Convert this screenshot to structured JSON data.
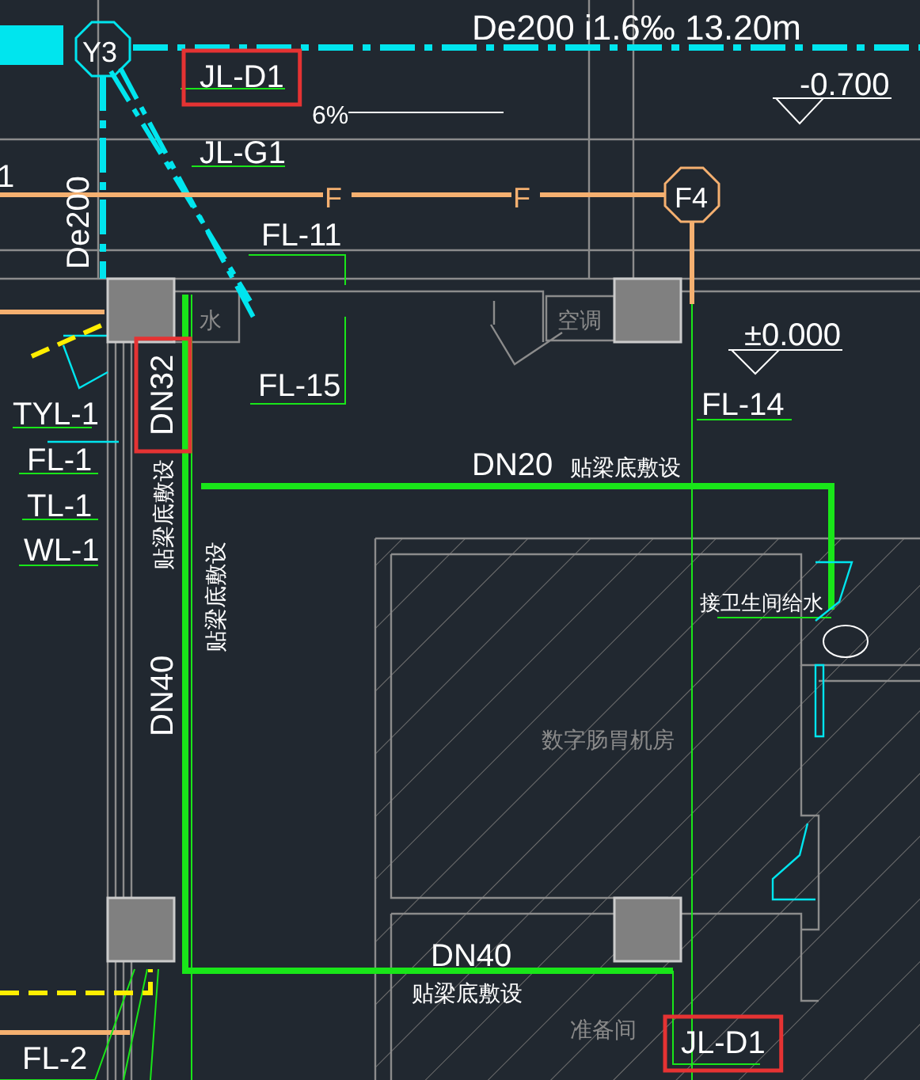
{
  "drawing": {
    "labels": [
      {
        "text": "Y3",
        "kind": "symbol",
        "vertical": false,
        "highlighted": false
      },
      {
        "text": "De200 i1.6‰ 13.20m",
        "kind": "tag",
        "vertical": false,
        "highlighted": false
      },
      {
        "text": "JL-D1",
        "kind": "tag",
        "vertical": false,
        "highlighted": true
      },
      {
        "text": "6%",
        "kind": "tag",
        "vertical": false,
        "highlighted": false
      },
      {
        "text": "-0.700",
        "kind": "tag",
        "vertical": false,
        "highlighted": false
      },
      {
        "text": "JL-G1",
        "kind": "tag",
        "vertical": false,
        "highlighted": false
      },
      {
        "text": "1",
        "kind": "tag",
        "vertical": false,
        "highlighted": false
      },
      {
        "text": "F",
        "kind": "line-marker",
        "vertical": false,
        "highlighted": false
      },
      {
        "text": "F",
        "kind": "line-marker",
        "vertical": false,
        "highlighted": false
      },
      {
        "text": "F4",
        "kind": "symbol",
        "vertical": false,
        "highlighted": false
      },
      {
        "text": "De200",
        "kind": "tag",
        "vertical": true,
        "highlighted": false
      },
      {
        "text": "FL-11",
        "kind": "tag",
        "vertical": false,
        "highlighted": false
      },
      {
        "text": "水",
        "kind": "room",
        "vertical": false,
        "highlighted": false
      },
      {
        "text": "空调",
        "kind": "room",
        "vertical": false,
        "highlighted": false
      },
      {
        "text": "±0.000",
        "kind": "tag",
        "vertical": false,
        "highlighted": false
      },
      {
        "text": "DN32",
        "kind": "tag",
        "vertical": true,
        "highlighted": true
      },
      {
        "text": "FL-15",
        "kind": "tag",
        "vertical": false,
        "highlighted": false
      },
      {
        "text": "FL-14",
        "kind": "tag",
        "vertical": false,
        "highlighted": false
      },
      {
        "text": "TYL-1",
        "kind": "tag",
        "vertical": false,
        "highlighted": false
      },
      {
        "text": "FL-1",
        "kind": "tag",
        "vertical": false,
        "highlighted": false
      },
      {
        "text": "TL-1",
        "kind": "tag",
        "vertical": false,
        "highlighted": false
      },
      {
        "text": "WL-1",
        "kind": "tag",
        "vertical": false,
        "highlighted": false
      },
      {
        "text": "DN20",
        "kind": "tag",
        "vertical": false,
        "highlighted": false
      },
      {
        "text": "贴梁底敷设",
        "kind": "note",
        "vertical": false,
        "highlighted": false
      },
      {
        "text": "贴梁底敷设",
        "kind": "note",
        "vertical": true,
        "highlighted": false
      },
      {
        "text": "贴梁底敷设",
        "kind": "note",
        "vertical": true,
        "highlighted": false
      },
      {
        "text": "接卫生间给水",
        "kind": "note",
        "vertical": false,
        "highlighted": false
      },
      {
        "text": "DN40",
        "kind": "tag",
        "vertical": true,
        "highlighted": false
      },
      {
        "text": "数字肠胃机房",
        "kind": "room",
        "vertical": false,
        "highlighted": false
      },
      {
        "text": "DN40",
        "kind": "tag",
        "vertical": false,
        "highlighted": false
      },
      {
        "text": "贴梁底敷设",
        "kind": "note",
        "vertical": false,
        "highlighted": false
      },
      {
        "text": "准备间",
        "kind": "room",
        "vertical": false,
        "highlighted": false
      },
      {
        "text": "JL-D1",
        "kind": "tag",
        "vertical": false,
        "highlighted": true
      },
      {
        "text": "FL-2",
        "kind": "tag",
        "vertical": false,
        "highlighted": false
      }
    ]
  }
}
